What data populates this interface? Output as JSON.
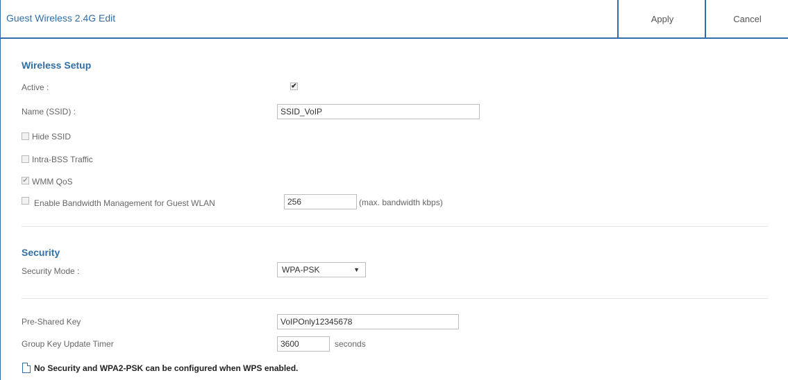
{
  "header": {
    "title": "Guest Wireless 2.4G Edit",
    "apply_label": "Apply",
    "cancel_label": "Cancel"
  },
  "wireless_setup": {
    "title": "Wireless Setup",
    "active_label": "Active :",
    "active_checked": true,
    "name_label": "Name (SSID) :",
    "name_value": "SSID_VoIP",
    "hide_ssid_label": "Hide SSID",
    "hide_ssid_checked": false,
    "intra_bss_label": "Intra-BSS Traffic",
    "intra_bss_checked": false,
    "wmm_qos_label": "WMM QoS",
    "wmm_qos_checked": true,
    "bandwidth_label": "Enable Bandwidth Management for Guest WLAN",
    "bandwidth_checked": false,
    "bandwidth_value": "256",
    "bandwidth_unit": "(max. bandwidth kbps)"
  },
  "security": {
    "title": "Security",
    "mode_label": "Security Mode :",
    "mode_value": "WPA-PSK",
    "psk_label": "Pre-Shared Key",
    "psk_value": "VoIPOnly12345678",
    "group_key_label": "Group Key Update Timer",
    "group_key_value": "3600",
    "group_key_unit": "seconds"
  },
  "note": {
    "text": "No Security and WPA2-PSK can be configured when WPS enabled."
  },
  "colors": {
    "accent": "#2f6ea8",
    "text": "#666666"
  }
}
